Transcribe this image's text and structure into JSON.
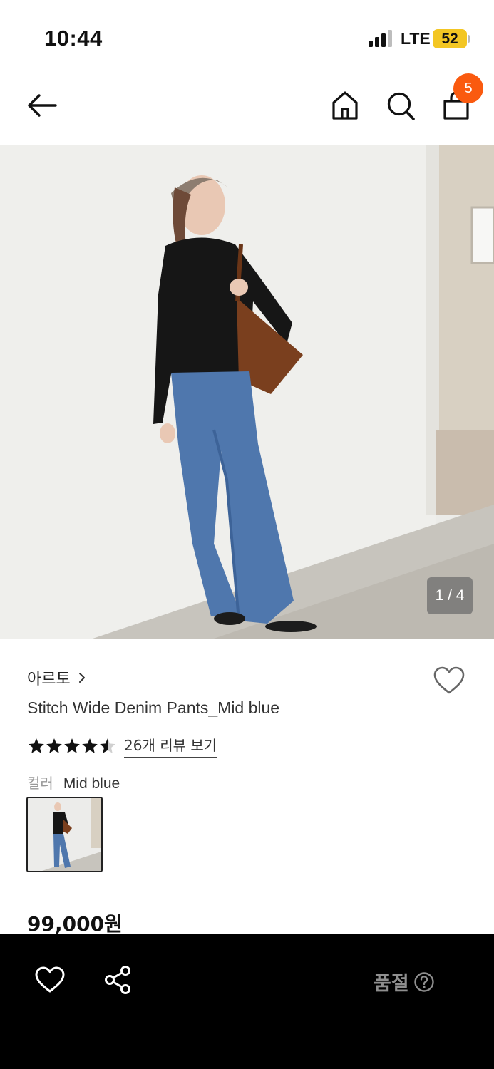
{
  "status_bar": {
    "time": "10:44",
    "network": "LTE",
    "battery": "52",
    "battery_color": "#f3c623"
  },
  "header": {
    "cart_count": "5",
    "badge_color": "#fa5a0f",
    "icons": [
      "back-arrow-icon",
      "home-icon",
      "search-icon",
      "shopping-bag-icon"
    ]
  },
  "gallery": {
    "counter": "1 / 4"
  },
  "product": {
    "brand": "아르토",
    "title": "Stitch Wide Denim Pants_Mid blue",
    "rating": 4.5,
    "review_link": "26개 리뷰 보기",
    "color_label": "컬러",
    "color_value": "Mid blue",
    "price": "99,000원"
  },
  "bottom_bar": {
    "status": "품절",
    "icons": [
      "heart-icon",
      "share-icon",
      "help-icon"
    ]
  }
}
